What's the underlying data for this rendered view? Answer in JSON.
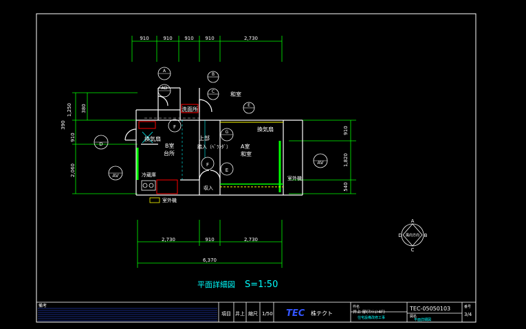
{
  "drawing": {
    "title": "平面詳細図",
    "scale": "S=1:50",
    "dim_top": [
      "910",
      "910",
      "910",
      "910",
      "2,730"
    ],
    "dim_bottom": [
      "2,730",
      "910",
      "2,730"
    ],
    "dim_total": "6,370",
    "dim_left": [
      "1,250",
      "380",
      "910",
      "2,060"
    ],
    "dim_left_total": "390",
    "dim_right": [
      "910",
      "1,820",
      "540"
    ]
  },
  "rooms": {
    "washitsu": "和室",
    "senmen": "洗面所",
    "kanki1": "換気扇",
    "kanki2": "換気扇",
    "b_room": "B室",
    "daidokoro": "台所",
    "roka": "上部",
    "nyuka": "踏入（ﾍﾞﾗﾝﾀﾞ）",
    "a_room": "A室",
    "a_washitsu": "和室",
    "reizou": "冷蔵庫",
    "shunou": "収入",
    "shitsugai1": "室外機",
    "shitsugai2": "室外機"
  },
  "markers": {
    "m1": "A",
    "m2": "AD",
    "m3": "B",
    "m4": "C",
    "m5": "E",
    "m6": "D",
    "m7": "F",
    "m8": "G",
    "m9": "AV"
  },
  "north": {
    "top": "A",
    "left": "D",
    "right": "B",
    "bottom": "C",
    "center": "風向方向"
  },
  "title_block": {
    "label_note": "備考",
    "label_item": "項目",
    "value_item": "井上",
    "label_scale": "縮尺",
    "value_scale": "1/50",
    "logo": "TEC",
    "company": "株テクト",
    "project_label": "件名",
    "project_value": "井上 邸(ﾏﾝｼｮﾝ4F)",
    "project_sub": "住宅設備改修工事",
    "drawing_label": "図名",
    "drawing_value": "平面詳細図",
    "code": "TEC-05050103",
    "sheet_label": "番号",
    "sheet_value": "3/4"
  }
}
